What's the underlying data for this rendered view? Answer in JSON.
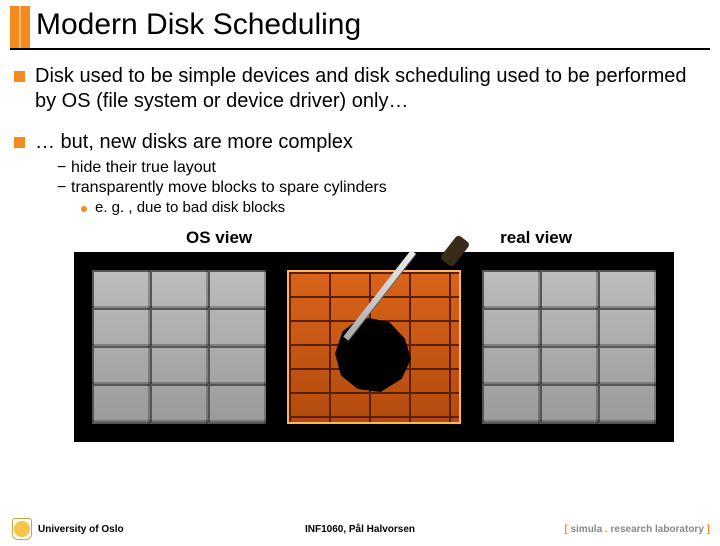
{
  "title": "Modern Disk Scheduling",
  "bullets": {
    "b1": "Disk used to be simple devices and disk scheduling used to be performed by OS (file system or device driver) only…",
    "b2": "… but, new disks are more complex",
    "b2_subs": {
      "s1": "hide their true layout",
      "s2": "transparently move blocks to spare cylinders",
      "s2_sub": "e. g. , due to bad disk blocks"
    }
  },
  "labels": {
    "os_view": "OS view",
    "real_view": "real view"
  },
  "footer": {
    "left": "University of Oslo",
    "center": "INF1060, Pål Halvorsen",
    "right_bracket_open": "[ ",
    "right_word1": "simula",
    "right_dot": " . ",
    "right_word2": "research laboratory",
    "right_bracket_close": " ]"
  }
}
